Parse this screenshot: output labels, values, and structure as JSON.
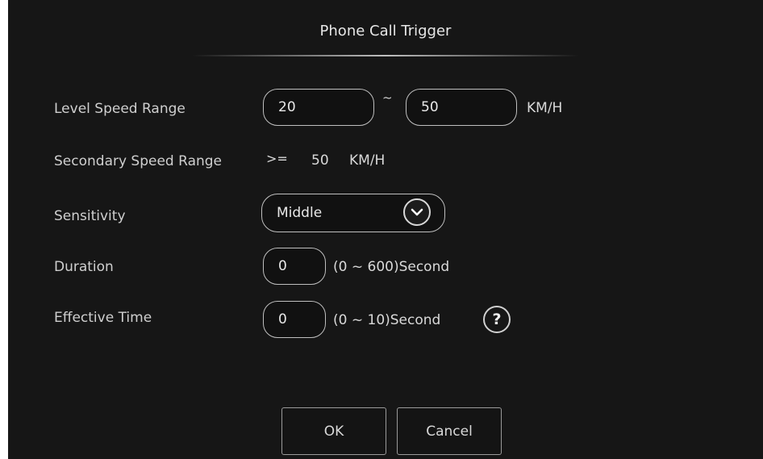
{
  "dialog": {
    "title": "Phone Call Trigger"
  },
  "level_speed": {
    "label": "Level Speed Range",
    "min_value": "20",
    "separator": "~",
    "max_value": "50",
    "unit": "KM/H"
  },
  "secondary_speed": {
    "label": "Secondary Speed Range",
    "operator": ">=",
    "value": "50",
    "unit": "KM/H"
  },
  "sensitivity": {
    "label": "Sensitivity",
    "value": "Middle"
  },
  "duration": {
    "label": "Duration",
    "value": "0",
    "hint": "(0 ~ 600)Second"
  },
  "effective_time": {
    "label": "Effective Time",
    "value": "0",
    "hint": "(0 ~ 10)Second",
    "help": "?"
  },
  "buttons": {
    "ok": "OK",
    "cancel": "Cancel"
  }
}
